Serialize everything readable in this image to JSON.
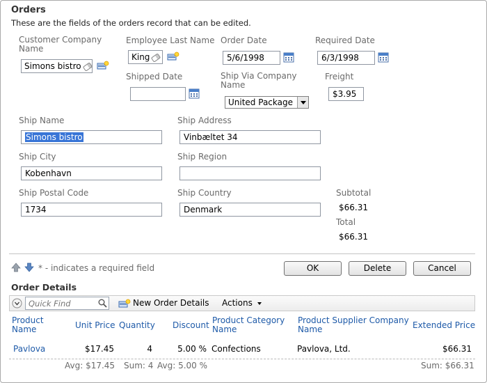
{
  "form": {
    "title": "Orders",
    "description": "These are the fields of the orders record that can be edited.",
    "fields": {
      "customer_company_name": {
        "label": "Customer Company Name",
        "value": "Simons bistro"
      },
      "employee_last_name": {
        "label": "Employee Last Name",
        "value": "King"
      },
      "order_date": {
        "label": "Order Date",
        "value": "5/6/1998"
      },
      "required_date": {
        "label": "Required Date",
        "value": "6/3/1998"
      },
      "shipped_date": {
        "label": "Shipped Date",
        "value": ""
      },
      "ship_via": {
        "label": "Ship Via Company Name",
        "value": "United Package"
      },
      "freight": {
        "label": "Freight",
        "value": "$3.95"
      },
      "ship_name": {
        "label": "Ship Name",
        "value": "Simons bistro"
      },
      "ship_address": {
        "label": "Ship Address",
        "value": "Vinbæltet 34"
      },
      "ship_city": {
        "label": "Ship City",
        "value": "Kobenhavn"
      },
      "ship_region": {
        "label": "Ship Region",
        "value": ""
      },
      "ship_postal_code": {
        "label": "Ship Postal Code",
        "value": "1734"
      },
      "ship_country": {
        "label": "Ship Country",
        "value": "Denmark"
      }
    },
    "subtotal": {
      "label": "Subtotal",
      "value": "$66.31"
    },
    "total": {
      "label": "Total",
      "value": "$66.31"
    },
    "required_note": "* - indicates a required field",
    "buttons": {
      "ok": "OK",
      "delete": "Delete",
      "cancel": "Cancel"
    }
  },
  "details": {
    "title": "Order Details",
    "toolbar": {
      "quick_find_placeholder": "Quick Find",
      "new_label": "New Order Details",
      "actions_label": "Actions"
    },
    "columns": [
      "Product Name",
      "Unit Price",
      "Quantity",
      "Discount",
      "Product Category Name",
      "Product Supplier Company Name",
      "Extended Price"
    ],
    "rows": [
      [
        "Pavlova",
        "$17.45",
        "4",
        "5.00 %",
        "Confections",
        "Pavlova, Ltd.",
        "$66.31"
      ]
    ],
    "footer": {
      "unit_price": "Avg: $17.45",
      "quantity": "Sum: 4",
      "discount": "Avg: 5.00 %",
      "extended_price": "Sum: $66.31"
    }
  },
  "colors": {
    "link": "#1e5aa8",
    "selection": "#3875d7",
    "label": "#6a6a6a"
  }
}
